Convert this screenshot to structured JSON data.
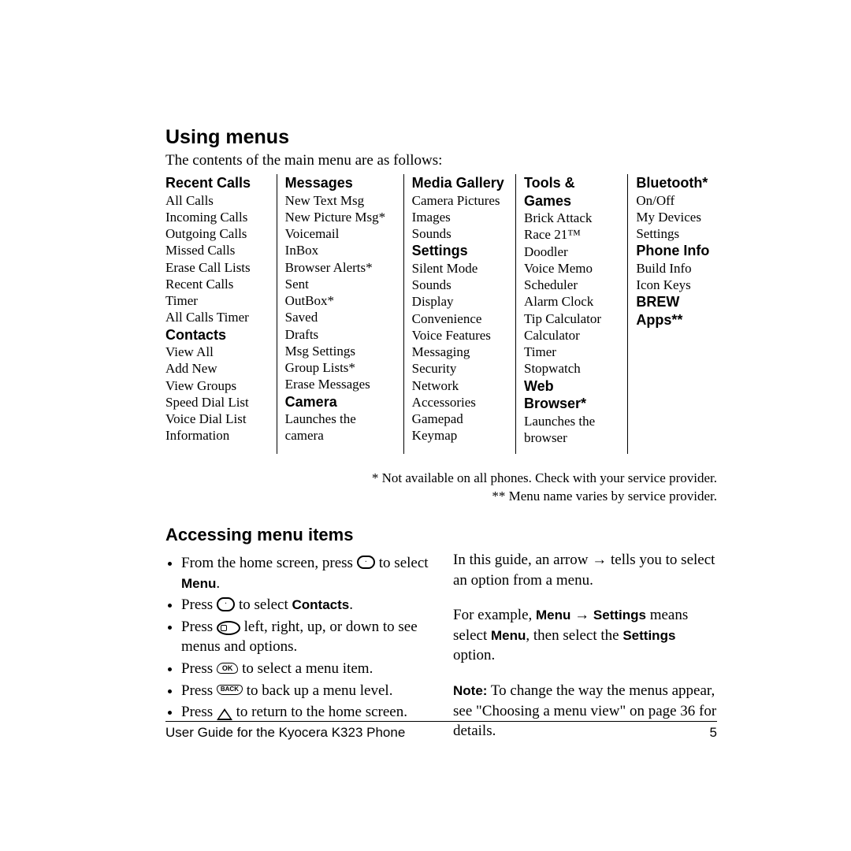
{
  "title": "Using menus",
  "intro": "The contents of the main menu are as follows:",
  "menu": {
    "col1": {
      "recent": {
        "header": "Recent Calls",
        "items": [
          "All Calls",
          "Incoming Calls",
          "Outgoing Calls",
          "Missed Calls",
          "Erase Call Lists",
          "Recent Calls Timer",
          "All Calls Timer"
        ]
      },
      "contacts": {
        "header": "Contacts",
        "items": [
          "View All",
          "Add New",
          "View Groups",
          "Speed Dial List",
          "Voice Dial List",
          "Information"
        ]
      }
    },
    "col2": {
      "messages": {
        "header": "Messages",
        "items": [
          "New Text Msg",
          "New Picture Msg*",
          "Voicemail",
          "InBox",
          "Browser Alerts*",
          "Sent",
          "OutBox*",
          "Saved",
          "Drafts",
          "Msg Settings",
          "Group Lists*",
          "Erase Messages"
        ]
      },
      "camera": {
        "header": "Camera",
        "items": [
          "Launches the camera"
        ]
      }
    },
    "col3": {
      "media": {
        "header": "Media Gallery",
        "items": [
          "Camera Pictures",
          "Images",
          "Sounds"
        ]
      },
      "settings": {
        "header": "Settings",
        "items": [
          "Silent Mode",
          "Sounds",
          "Display",
          "Convenience",
          "Voice Features",
          "Messaging",
          "Security",
          "Network",
          "Accessories",
          "Gamepad Keymap"
        ]
      }
    },
    "col4": {
      "tools": {
        "header": "Tools & Games",
        "items": [
          "Brick Attack",
          "Race 21™",
          "Doodler",
          "Voice Memo",
          "Scheduler",
          "Alarm Clock",
          "Tip Calculator",
          "Calculator",
          "Timer",
          "Stopwatch"
        ]
      },
      "web": {
        "header": "Web Browser*",
        "items": [
          "Launches the browser"
        ]
      }
    },
    "col5": {
      "bt": {
        "header": "Bluetooth*",
        "items": [
          "On/Off",
          "My Devices",
          "Settings"
        ]
      },
      "phone": {
        "header": "Phone Info",
        "items": [
          "Build Info",
          "Icon Keys"
        ]
      },
      "brew": {
        "header": "BREW Apps**"
      }
    }
  },
  "footnote1": "* Not available on all phones. Check with your service provider.",
  "footnote2": "** Menu name varies by service provider.",
  "access": {
    "header": "Accessing menu items",
    "left": {
      "b1a": "From the home screen, press ",
      "b1b": " to select ",
      "b1c": "Menu",
      "b1d": ".",
      "b2a": "Press ",
      "b2b": " to select ",
      "b2c": "Contacts",
      "b2d": ".",
      "b3a": "Press ",
      "b3b": " left, right, up, or down to see menus and options.",
      "b4a": "Press ",
      "b4b": " to select a menu item.",
      "b5a": "Press ",
      "b5b": " to back up a menu level.",
      "b6a": "Press ",
      "b6b": " to return to the home screen."
    },
    "right": {
      "p1": "In this guide, an arrow → tells you to select an option from a menu.",
      "p2a": "For example, ",
      "p2b": "Menu",
      "p2c": " → ",
      "p2d": "Settings",
      "p2e": " means select ",
      "p2f": "Menu",
      "p2g": ", then select the ",
      "p2h": "Settings",
      "p2i": " option.",
      "p3a": "Note:",
      "p3b": "  To change the way the menus appear, see \"Choosing a menu view\" on page 36 for details."
    }
  },
  "footer": {
    "left": "User Guide for the Kyocera K323 Phone",
    "right": "5"
  }
}
